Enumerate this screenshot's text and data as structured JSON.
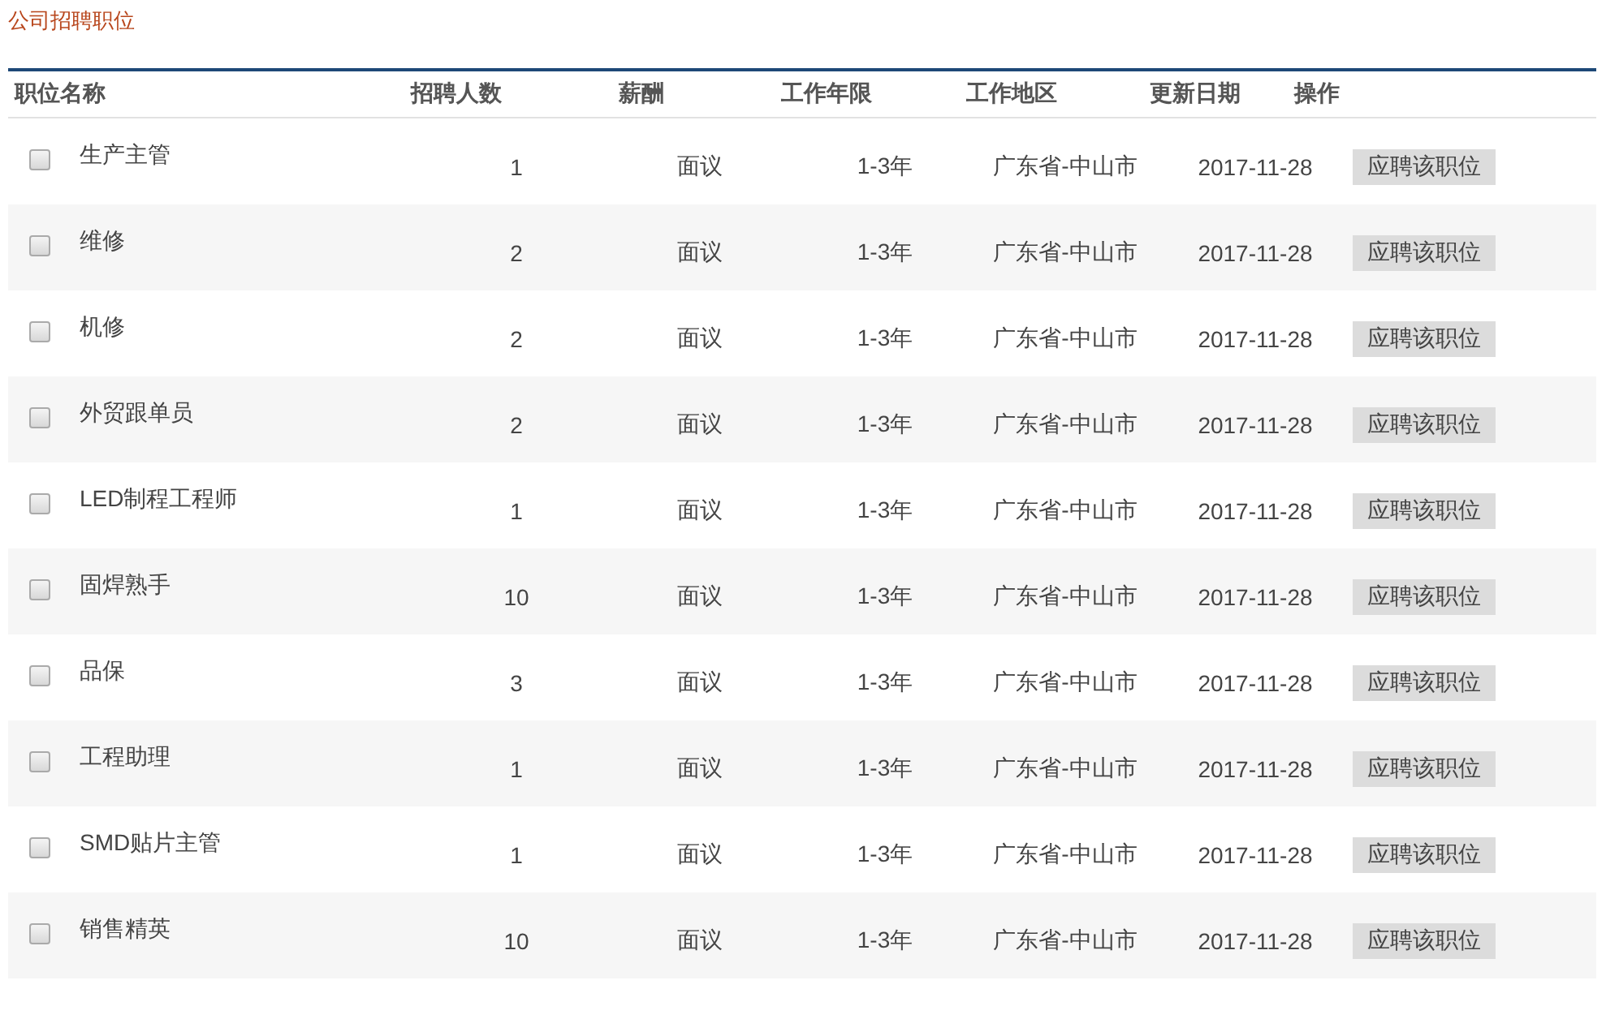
{
  "title": "公司招聘职位",
  "table": {
    "columns": [
      "职位名称",
      "招聘人数",
      "薪酬",
      "工作年限",
      "工作地区",
      "更新日期",
      "操作"
    ],
    "rows": [
      {
        "checked": false,
        "name": "生产主管",
        "count": "1",
        "salary": "面议",
        "years": "1-3年",
        "region": "广东省-中山市",
        "date": "2017-11-28",
        "action": "应聘该职位"
      },
      {
        "checked": false,
        "name": "维修",
        "count": "2",
        "salary": "面议",
        "years": "1-3年",
        "region": "广东省-中山市",
        "date": "2017-11-28",
        "action": "应聘该职位"
      },
      {
        "checked": false,
        "name": "机修",
        "count": "2",
        "salary": "面议",
        "years": "1-3年",
        "region": "广东省-中山市",
        "date": "2017-11-28",
        "action": "应聘该职位"
      },
      {
        "checked": false,
        "name": "外贸跟单员",
        "count": "2",
        "salary": "面议",
        "years": "1-3年",
        "region": "广东省-中山市",
        "date": "2017-11-28",
        "action": "应聘该职位"
      },
      {
        "checked": false,
        "name": "LED制程工程师",
        "count": "1",
        "salary": "面议",
        "years": "1-3年",
        "region": "广东省-中山市",
        "date": "2017-11-28",
        "action": "应聘该职位"
      },
      {
        "checked": false,
        "name": "固焊熟手",
        "count": "10",
        "salary": "面议",
        "years": "1-3年",
        "region": "广东省-中山市",
        "date": "2017-11-28",
        "action": "应聘该职位"
      },
      {
        "checked": false,
        "name": "品保",
        "count": "3",
        "salary": "面议",
        "years": "1-3年",
        "region": "广东省-中山市",
        "date": "2017-11-28",
        "action": "应聘该职位"
      },
      {
        "checked": false,
        "name": "工程助理",
        "count": "1",
        "salary": "面议",
        "years": "1-3年",
        "region": "广东省-中山市",
        "date": "2017-11-28",
        "action": "应聘该职位"
      },
      {
        "checked": false,
        "name": "SMD贴片主管",
        "count": "1",
        "salary": "面议",
        "years": "1-3年",
        "region": "广东省-中山市",
        "date": "2017-11-28",
        "action": "应聘该职位"
      },
      {
        "checked": false,
        "name": "销售精英",
        "count": "10",
        "salary": "面议",
        "years": "1-3年",
        "region": "广东省-中山市",
        "date": "2017-11-28",
        "action": "应聘该职位"
      }
    ]
  }
}
